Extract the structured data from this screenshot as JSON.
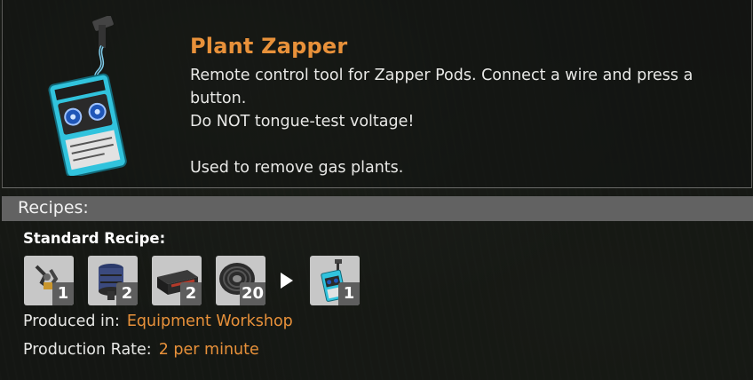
{
  "item": {
    "title": "Plant Zapper",
    "description": "Remote control tool for Zapper Pods. Connect a wire and press a button.\nDo NOT tongue-test voltage!\n\nUsed to remove gas plants."
  },
  "recipes": {
    "header": "Recipes:",
    "recipe_name": "Standard Recipe:",
    "ingredients": [
      {
        "icon": "claw-part-icon",
        "qty": "1"
      },
      {
        "icon": "motor-icon",
        "qty": "2"
      },
      {
        "icon": "battery-icon",
        "qty": "2"
      },
      {
        "icon": "wire-coil-icon",
        "qty": "20"
      }
    ],
    "output": {
      "icon": "plant-zapper-icon",
      "qty": "1"
    },
    "produced_in_label": "Produced in:",
    "produced_in_value": "Equipment Workshop",
    "rate_label": "Production Rate:",
    "rate_value": "2 per minute"
  },
  "colors": {
    "accent": "#e8913a",
    "bar": "#626262",
    "slot": "#c7c7c7"
  }
}
